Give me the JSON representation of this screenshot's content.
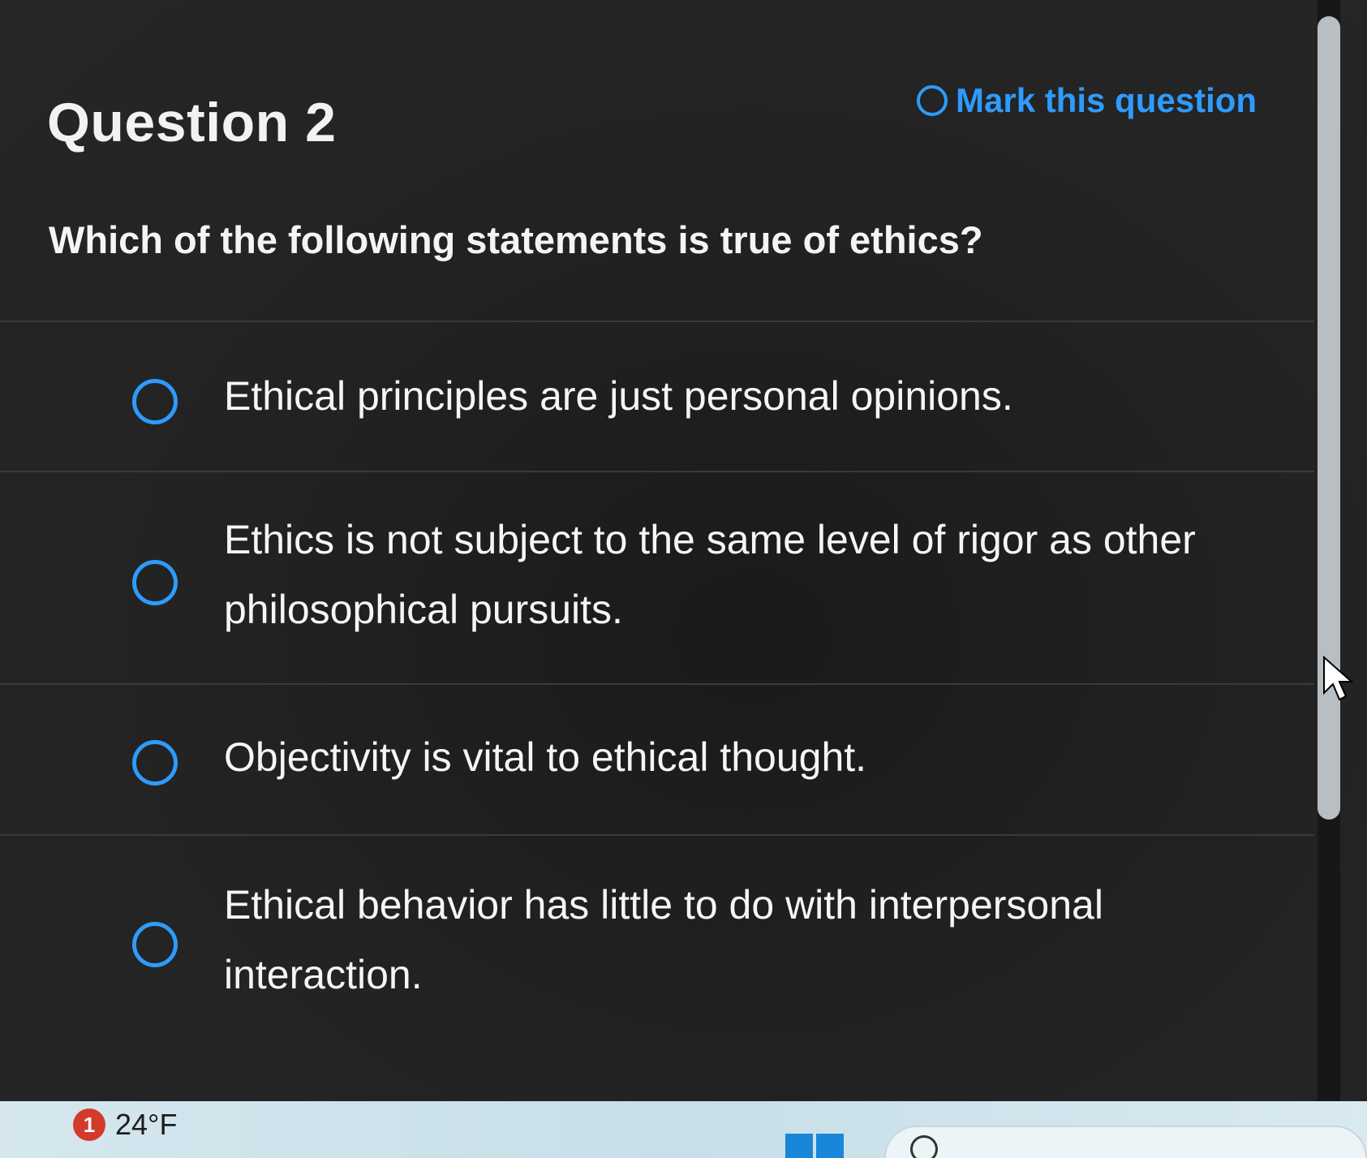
{
  "question": {
    "title": "Question 2",
    "mark_label": "Mark this question",
    "prompt": "Which of the following statements is true of ethics?"
  },
  "options": [
    {
      "text": "Ethical principles are just personal opinions."
    },
    {
      "text": "Ethics is not subject to the same level of rigor as other philosophical pursuits."
    },
    {
      "text": "Objectivity is vital to ethical thought."
    },
    {
      "text": "Ethical behavior has little to do with interpersonal interaction."
    }
  ],
  "taskbar": {
    "notification_count": "1",
    "temperature": "24°F"
  },
  "colors": {
    "accent": "#2e9bff",
    "background": "#232323",
    "text": "#f5f5f5"
  }
}
